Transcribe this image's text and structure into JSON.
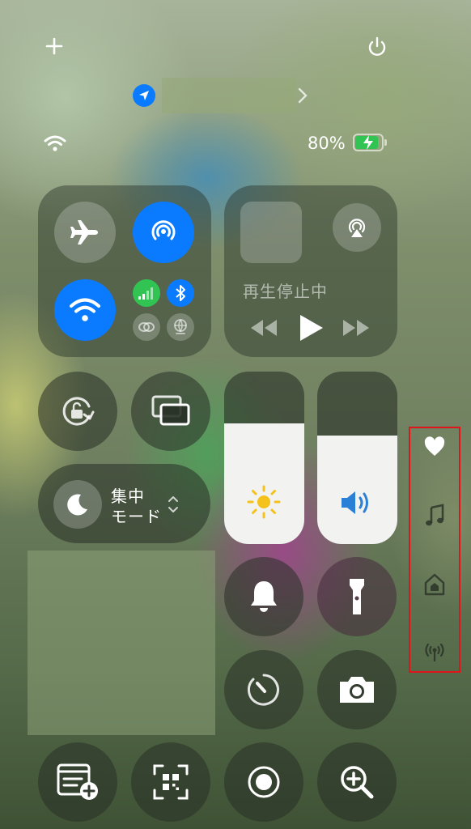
{
  "status": {
    "battery_percent": "80%",
    "location_label": ""
  },
  "media": {
    "status_text": "再生停止中"
  },
  "focus": {
    "line1": "集中",
    "line2": "モード"
  },
  "levels": {
    "brightness": 0.7,
    "volume": 0.65
  },
  "colors": {
    "accent_blue": "#0a7bff",
    "cellular_green": "#32c453",
    "highlight_red": "#e0151b"
  },
  "side_icons": [
    "heart-icon",
    "music-note-icon",
    "home-icon",
    "antenna-icon"
  ]
}
